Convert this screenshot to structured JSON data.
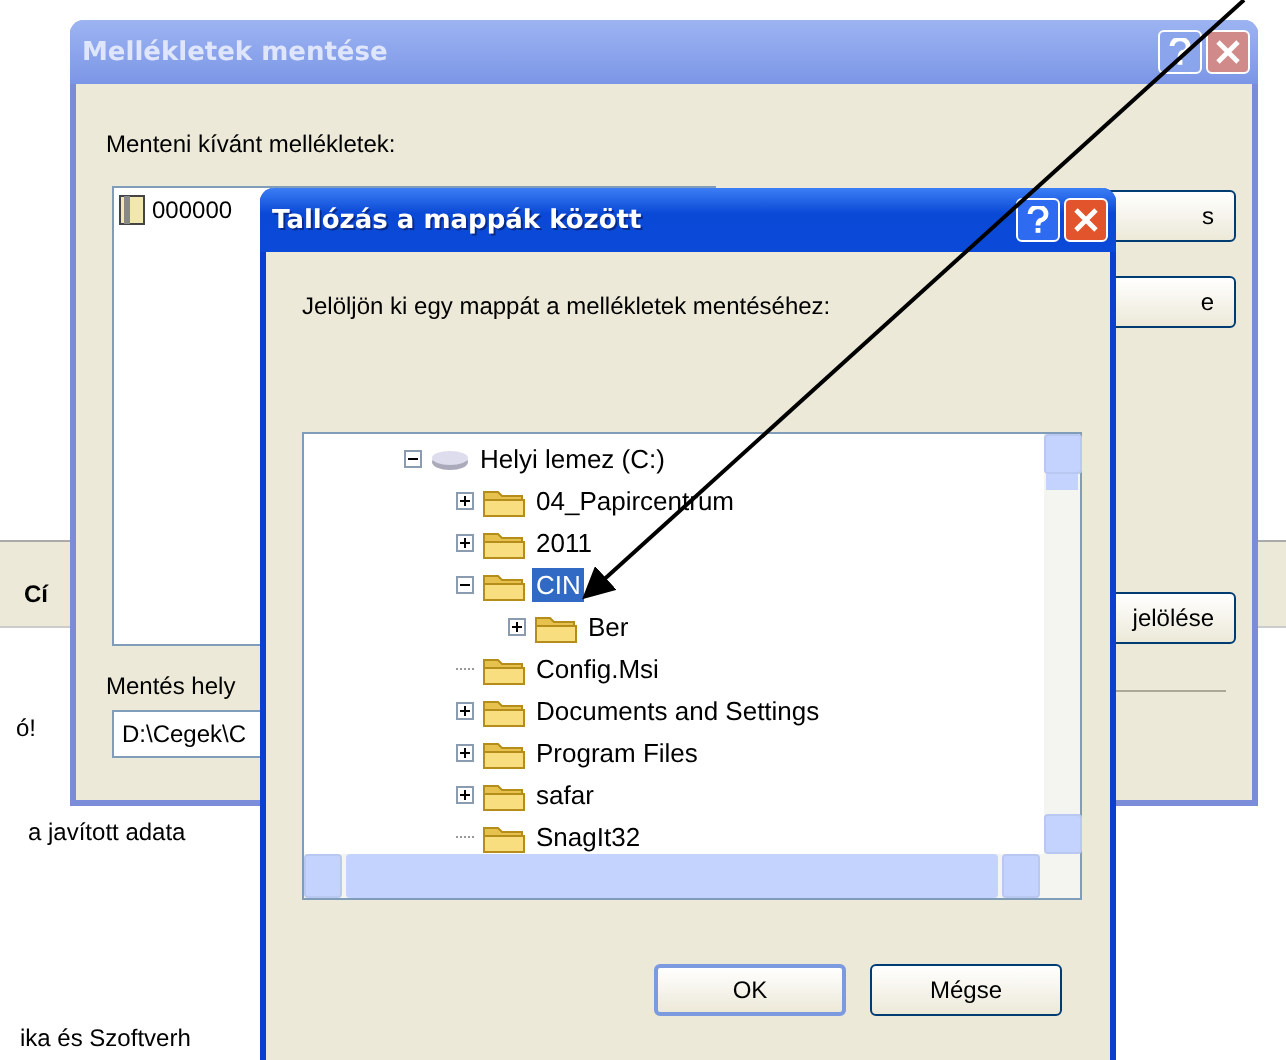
{
  "background_page": {
    "header_text": "Cí",
    "lines": [
      {
        "text": "ó!"
      },
      {
        "text": "a javított adata"
      },
      {
        "text": "ika és Szoftverh"
      }
    ]
  },
  "save_dialog": {
    "title": "Mellékletek mentése",
    "active": false,
    "list_label": "Menteni kívánt mellékletek:",
    "attachments": [
      "000000"
    ],
    "buttons": [
      "s",
      "e",
      "jelölése"
    ],
    "location_label": "Mentés hely",
    "location_value": "D:\\Cegek\\C"
  },
  "browse_dialog": {
    "title": "Tallózás a mappák között",
    "active": true,
    "prompt": "Jelöljön ki egy mappát a mellékletek mentéséhez:",
    "tree": [
      {
        "label": "Helyi lemez (C:)",
        "kind": "drive",
        "expandable": true,
        "expanded": true,
        "selected": false,
        "children": [
          {
            "label": "04_Papircentrum",
            "kind": "folder",
            "expandable": true,
            "expanded": false,
            "selected": false
          },
          {
            "label": "2011",
            "kind": "folder",
            "expandable": true,
            "expanded": false,
            "selected": false
          },
          {
            "label": "CIN",
            "kind": "folder",
            "expandable": true,
            "expanded": true,
            "selected": true,
            "children": [
              {
                "label": "Ber",
                "kind": "folder",
                "expandable": true,
                "expanded": false,
                "selected": false
              }
            ]
          },
          {
            "label": "Config.Msi",
            "kind": "folder",
            "expandable": false,
            "selected": false
          },
          {
            "label": "Documents and Settings",
            "kind": "folder",
            "expandable": true,
            "expanded": false,
            "selected": false
          },
          {
            "label": "Program Files",
            "kind": "folder",
            "expandable": true,
            "expanded": false,
            "selected": false
          },
          {
            "label": "safar",
            "kind": "folder",
            "expandable": true,
            "expanded": false,
            "selected": false
          },
          {
            "label": "SnagIt32",
            "kind": "folder",
            "expandable": false,
            "selected": false
          }
        ]
      }
    ],
    "buttons": [
      "OK",
      "Mégse"
    ]
  }
}
